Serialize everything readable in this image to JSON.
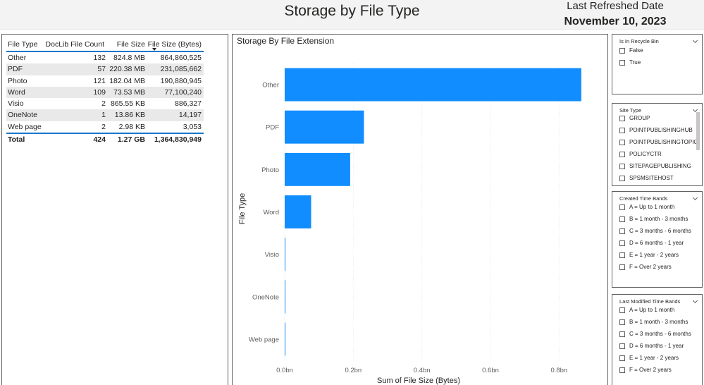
{
  "header": {
    "title": "Storage by File Type",
    "refresh_label": "Last Refreshed Date",
    "refresh_date": "November 10, 2023"
  },
  "table": {
    "columns": [
      "File Type",
      "DocLib File Count",
      "File Size",
      "File Size (Bytes)"
    ],
    "sorted_column": "File Size (Bytes)",
    "rows": [
      {
        "type": "Other",
        "count": "132",
        "size": "824.8 MB",
        "bytes": "864,860,525"
      },
      {
        "type": "PDF",
        "count": "57",
        "size": "220.38 MB",
        "bytes": "231,085,662"
      },
      {
        "type": "Photo",
        "count": "121",
        "size": "182.04 MB",
        "bytes": "190,880,945"
      },
      {
        "type": "Word",
        "count": "109",
        "size": "73.53 MB",
        "bytes": "77,100,240"
      },
      {
        "type": "Visio",
        "count": "2",
        "size": "865.55 KB",
        "bytes": "886,327"
      },
      {
        "type": "OneNote",
        "count": "1",
        "size": "13.86 KB",
        "bytes": "14,197"
      },
      {
        "type": "Web page",
        "count": "2",
        "size": "2.98 KB",
        "bytes": "3,053"
      }
    ],
    "total": {
      "label": "Total",
      "count": "424",
      "size": "1.27 GB",
      "bytes": "1,364,830,949"
    }
  },
  "chart_data": {
    "type": "bar",
    "orientation": "horizontal",
    "title": "Storage By File Extension",
    "xlabel": "Sum of File Size (Bytes)",
    "ylabel": "File Type",
    "categories": [
      "Other",
      "PDF",
      "Photo",
      "Word",
      "Visio",
      "OneNote",
      "Web page"
    ],
    "values": [
      864860525,
      231085662,
      190880945,
      77100240,
      886327,
      14197,
      3053
    ],
    "xlim": [
      0,
      900000000
    ],
    "xticks": [
      0,
      200000000,
      400000000,
      600000000,
      800000000
    ],
    "xtick_labels": [
      "0.0bn",
      "0.2bn",
      "0.4bn",
      "0.6bn",
      "0.8bn"
    ],
    "bar_color": "#118dff",
    "grid": true
  },
  "slicers": {
    "recycle": {
      "title": "Is In Recycle Bin",
      "options": [
        "False",
        "True"
      ]
    },
    "site_type": {
      "title": "Site Type",
      "options": [
        "GROUP",
        "POINTPUBLISHINGHUB",
        "POINTPUBLISHINGTOPIC",
        "POLICYCTR",
        "SITEPAGEPUBLISHING",
        "SPSMSITEHOST"
      ]
    },
    "created": {
      "title": "Created Time Bands",
      "options": [
        "A = Up to 1 month",
        "B = 1 month - 3 months",
        "C = 3 months - 6 months",
        "D = 6 months - 1 year",
        "E = 1 year - 2 years",
        "F = Over 2 years"
      ]
    },
    "modified": {
      "title": "Last Modified Time Bands",
      "options": [
        "A = Up to 1 month",
        "B = 1 month - 3 months",
        "C = 3 months - 6 months",
        "D = 6 months - 1 year",
        "E = 1 year - 2 years",
        "F = Over 2 years"
      ]
    }
  },
  "icons": {
    "slicer_menu": "chevron-down-icon",
    "sort": "sort-descending-icon"
  }
}
